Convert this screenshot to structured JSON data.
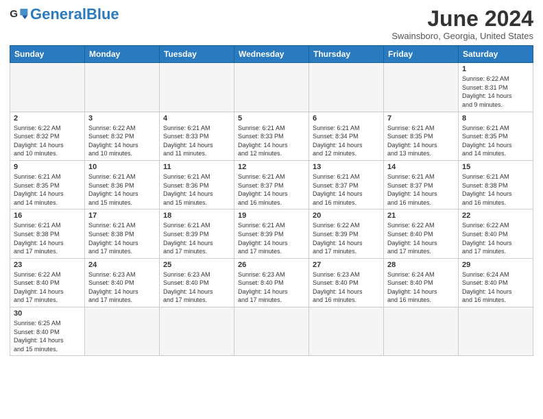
{
  "header": {
    "logo_general": "General",
    "logo_blue": "Blue",
    "month": "June 2024",
    "location": "Swainsboro, Georgia, United States"
  },
  "weekdays": [
    "Sunday",
    "Monday",
    "Tuesday",
    "Wednesday",
    "Thursday",
    "Friday",
    "Saturday"
  ],
  "weeks": [
    [
      {
        "day": "",
        "info": ""
      },
      {
        "day": "",
        "info": ""
      },
      {
        "day": "",
        "info": ""
      },
      {
        "day": "",
        "info": ""
      },
      {
        "day": "",
        "info": ""
      },
      {
        "day": "",
        "info": ""
      },
      {
        "day": "1",
        "info": "Sunrise: 6:22 AM\nSunset: 8:31 PM\nDaylight: 14 hours\nand 9 minutes."
      }
    ],
    [
      {
        "day": "2",
        "info": "Sunrise: 6:22 AM\nSunset: 8:32 PM\nDaylight: 14 hours\nand 10 minutes."
      },
      {
        "day": "3",
        "info": "Sunrise: 6:22 AM\nSunset: 8:32 PM\nDaylight: 14 hours\nand 10 minutes."
      },
      {
        "day": "4",
        "info": "Sunrise: 6:21 AM\nSunset: 8:33 PM\nDaylight: 14 hours\nand 11 minutes."
      },
      {
        "day": "5",
        "info": "Sunrise: 6:21 AM\nSunset: 8:33 PM\nDaylight: 14 hours\nand 12 minutes."
      },
      {
        "day": "6",
        "info": "Sunrise: 6:21 AM\nSunset: 8:34 PM\nDaylight: 14 hours\nand 12 minutes."
      },
      {
        "day": "7",
        "info": "Sunrise: 6:21 AM\nSunset: 8:35 PM\nDaylight: 14 hours\nand 13 minutes."
      },
      {
        "day": "8",
        "info": "Sunrise: 6:21 AM\nSunset: 8:35 PM\nDaylight: 14 hours\nand 14 minutes."
      }
    ],
    [
      {
        "day": "9",
        "info": "Sunrise: 6:21 AM\nSunset: 8:35 PM\nDaylight: 14 hours\nand 14 minutes."
      },
      {
        "day": "10",
        "info": "Sunrise: 6:21 AM\nSunset: 8:36 PM\nDaylight: 14 hours\nand 15 minutes."
      },
      {
        "day": "11",
        "info": "Sunrise: 6:21 AM\nSunset: 8:36 PM\nDaylight: 14 hours\nand 15 minutes."
      },
      {
        "day": "12",
        "info": "Sunrise: 6:21 AM\nSunset: 8:37 PM\nDaylight: 14 hours\nand 16 minutes."
      },
      {
        "day": "13",
        "info": "Sunrise: 6:21 AM\nSunset: 8:37 PM\nDaylight: 14 hours\nand 16 minutes."
      },
      {
        "day": "14",
        "info": "Sunrise: 6:21 AM\nSunset: 8:37 PM\nDaylight: 14 hours\nand 16 minutes."
      },
      {
        "day": "15",
        "info": "Sunrise: 6:21 AM\nSunset: 8:38 PM\nDaylight: 14 hours\nand 16 minutes."
      }
    ],
    [
      {
        "day": "16",
        "info": "Sunrise: 6:21 AM\nSunset: 8:38 PM\nDaylight: 14 hours\nand 17 minutes."
      },
      {
        "day": "17",
        "info": "Sunrise: 6:21 AM\nSunset: 8:38 PM\nDaylight: 14 hours\nand 17 minutes."
      },
      {
        "day": "18",
        "info": "Sunrise: 6:21 AM\nSunset: 8:39 PM\nDaylight: 14 hours\nand 17 minutes."
      },
      {
        "day": "19",
        "info": "Sunrise: 6:21 AM\nSunset: 8:39 PM\nDaylight: 14 hours\nand 17 minutes."
      },
      {
        "day": "20",
        "info": "Sunrise: 6:22 AM\nSunset: 8:39 PM\nDaylight: 14 hours\nand 17 minutes."
      },
      {
        "day": "21",
        "info": "Sunrise: 6:22 AM\nSunset: 8:40 PM\nDaylight: 14 hours\nand 17 minutes."
      },
      {
        "day": "22",
        "info": "Sunrise: 6:22 AM\nSunset: 8:40 PM\nDaylight: 14 hours\nand 17 minutes."
      }
    ],
    [
      {
        "day": "23",
        "info": "Sunrise: 6:22 AM\nSunset: 8:40 PM\nDaylight: 14 hours\nand 17 minutes."
      },
      {
        "day": "24",
        "info": "Sunrise: 6:23 AM\nSunset: 8:40 PM\nDaylight: 14 hours\nand 17 minutes."
      },
      {
        "day": "25",
        "info": "Sunrise: 6:23 AM\nSunset: 8:40 PM\nDaylight: 14 hours\nand 17 minutes."
      },
      {
        "day": "26",
        "info": "Sunrise: 6:23 AM\nSunset: 8:40 PM\nDaylight: 14 hours\nand 17 minutes."
      },
      {
        "day": "27",
        "info": "Sunrise: 6:23 AM\nSunset: 8:40 PM\nDaylight: 14 hours\nand 16 minutes."
      },
      {
        "day": "28",
        "info": "Sunrise: 6:24 AM\nSunset: 8:40 PM\nDaylight: 14 hours\nand 16 minutes."
      },
      {
        "day": "29",
        "info": "Sunrise: 6:24 AM\nSunset: 8:40 PM\nDaylight: 14 hours\nand 16 minutes."
      }
    ],
    [
      {
        "day": "30",
        "info": "Sunrise: 6:25 AM\nSunset: 8:40 PM\nDaylight: 14 hours\nand 15 minutes."
      },
      {
        "day": "",
        "info": ""
      },
      {
        "day": "",
        "info": ""
      },
      {
        "day": "",
        "info": ""
      },
      {
        "day": "",
        "info": ""
      },
      {
        "day": "",
        "info": ""
      },
      {
        "day": "",
        "info": ""
      }
    ]
  ]
}
